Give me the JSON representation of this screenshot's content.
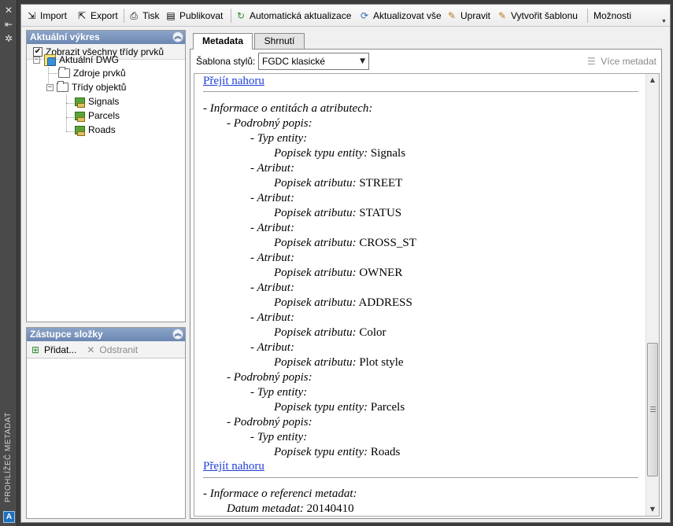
{
  "strip": {
    "title": "PROHLÍŽEČ METADAT",
    "logo": "A"
  },
  "toolbar": {
    "import": "Import",
    "export": "Export",
    "print": "Tisk",
    "publish": "Publikovat",
    "auto_update": "Automatická aktualizace",
    "update_all": "Aktualizovat vše",
    "edit": "Upravit",
    "create_template": "Vytvořit šablonu",
    "options": "Možnosti"
  },
  "current_drawing_panel": {
    "title": "Aktuální výkres",
    "show_all_label": "Zobrazit všechny třídy prvků",
    "show_all_checked": true,
    "tree": {
      "root": "Aktuální DWG",
      "sources": "Zdroje prvků",
      "classes": "Třídy objektů",
      "layers": [
        "Signals",
        "Parcels",
        "Roads"
      ]
    }
  },
  "proxy_panel": {
    "title": "Zástupce složky",
    "add": "Přidat...",
    "remove": "Odstranit"
  },
  "tabs": {
    "metadata": "Metadata",
    "summary": "Shrnutí"
  },
  "style_bar": {
    "label": "Šablona stylů:",
    "selected": "FGDC klasické",
    "more_metadata": "Více metadat"
  },
  "document": {
    "top_link": "Přejít nahoru",
    "entity_section": "- Informace o entitách a atributech:",
    "detail_label": "- Podrobný popis:",
    "entity_type_label": "- Typ entity:",
    "entity_type_caption": "Popisek typu entity:",
    "attribute_label": "- Atribut:",
    "attribute_caption": "Popisek atributu:",
    "entities": [
      {
        "type": "Signals",
        "attributes": [
          "STREET",
          "STATUS",
          "CROSS_ST",
          "OWNER",
          "ADDRESS",
          "Color",
          "Plot style"
        ]
      },
      {
        "type": "Parcels",
        "attributes": []
      },
      {
        "type": "Roads",
        "attributes": []
      }
    ],
    "reference_section": "- Informace o referenci metadat:",
    "date_caption": "Datum metadat:",
    "date_value": "20140410"
  },
  "colors": {
    "panel_header": "#6c87b3",
    "link": "#1f3fd6",
    "app_frame": "#3c3c3c"
  }
}
